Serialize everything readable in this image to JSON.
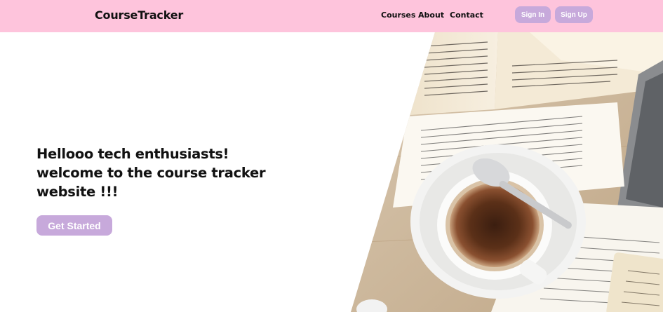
{
  "navbar": {
    "brand": "CourseTracker",
    "links": [
      "Courses",
      "About",
      "Contact"
    ],
    "signin_label": "Sign In",
    "signup_label": "Sign Up"
  },
  "hero": {
    "line1": "Hellooo tech enthusiasts!",
    "line2": "welcome to the course tracker",
    "line3": "website !!!",
    "cta_label": "Get Started",
    "image_label": "coffee-and-books-photo"
  },
  "colors": {
    "navbar_bg": "#fec4dc",
    "button_bg": "#c7a9db",
    "text": "#111111"
  }
}
